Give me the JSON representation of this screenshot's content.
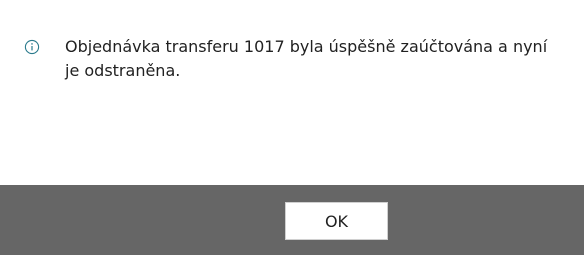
{
  "dialog": {
    "icon": "info-icon",
    "icon_color": "#2a7a8c",
    "message": "Objednávka transferu 1017 byla úspěšně zaúčtována a nyní je odstraněna.",
    "ok_label": "OK",
    "footer_color": "#666666"
  }
}
